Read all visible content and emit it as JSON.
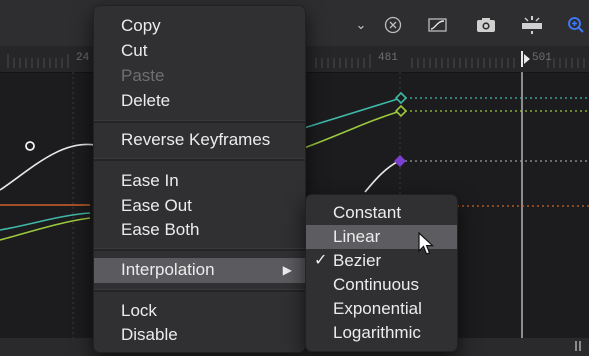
{
  "ruler": {
    "labels": [
      "24",
      "481",
      "501"
    ]
  },
  "toolbar": {
    "icons": [
      "chevron-down-icon",
      "close-circle-icon",
      "keyframe-curve-icon",
      "camera-icon",
      "snap-icon",
      "magnify-icon"
    ],
    "accent_color": "#3f7bff"
  },
  "context_menu": {
    "items": [
      {
        "label": "Copy",
        "enabled": true
      },
      {
        "label": "Cut",
        "enabled": true
      },
      {
        "label": "Paste",
        "enabled": false
      },
      {
        "label": "Delete",
        "enabled": true
      },
      {
        "label": "Reverse Keyframes",
        "enabled": true
      },
      {
        "label": "Ease In",
        "enabled": true
      },
      {
        "label": "Ease Out",
        "enabled": true
      },
      {
        "label": "Ease Both",
        "enabled": true
      },
      {
        "label": "Interpolation",
        "enabled": true,
        "submenu_arrow": "▶",
        "highlighted": true
      },
      {
        "label": "Lock",
        "enabled": true
      },
      {
        "label": "Disable",
        "enabled": true
      }
    ]
  },
  "submenu": {
    "items": [
      {
        "label": "Constant"
      },
      {
        "label": "Linear",
        "highlighted": true
      },
      {
        "label": "Bezier",
        "checked": true,
        "checkmark": "✓"
      },
      {
        "label": "Continuous"
      },
      {
        "label": "Exponential"
      },
      {
        "label": "Logarithmic"
      }
    ]
  },
  "curve_colors": {
    "teal": "#3fb7a6",
    "green": "#9cc83f",
    "purple": "#7b3fd0",
    "orange": "#d0622b",
    "white": "#e8e8e8"
  }
}
